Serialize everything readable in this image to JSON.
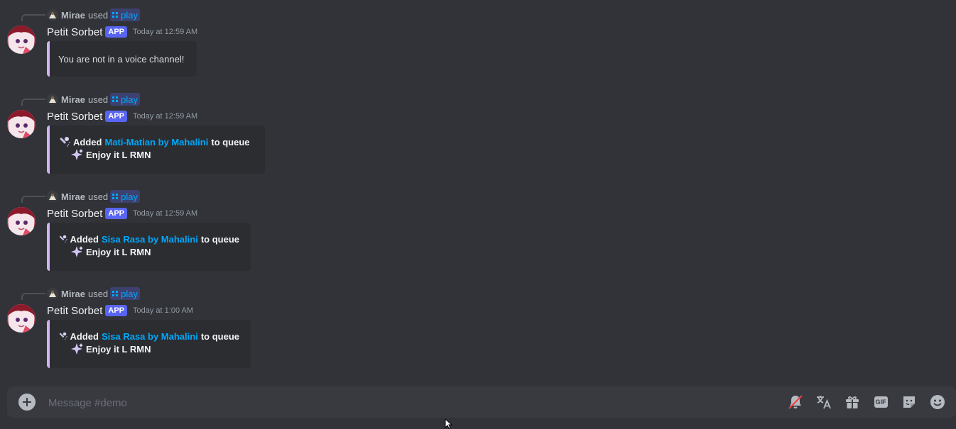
{
  "messages": [
    {
      "reply_user": "Mirae",
      "reply_used": "used",
      "command": "play",
      "bot_name": "Petit Sorbet",
      "badge": "APP",
      "timestamp": "Today at 12:59 AM",
      "embed_text": "You are not in a voice channel!"
    },
    {
      "reply_user": "Mirae",
      "reply_used": "used",
      "command": "play",
      "bot_name": "Petit Sorbet",
      "badge": "APP",
      "timestamp": "Today at 12:59 AM",
      "added_label": "Added",
      "song": "Mati-Matian by Mahalini",
      "to_queue": "to queue",
      "footer": "Enjoy it L RMN"
    },
    {
      "reply_user": "Mirae",
      "reply_used": "used",
      "command": "play",
      "bot_name": "Petit Sorbet",
      "badge": "APP",
      "timestamp": "Today at 12:59 AM",
      "added_label": "Added",
      "song": "Sisa Rasa by Mahalini",
      "to_queue": "to queue",
      "footer": "Enjoy it L RMN"
    },
    {
      "reply_user": "Mirae",
      "reply_used": "used",
      "command": "play",
      "bot_name": "Petit Sorbet",
      "badge": "APP",
      "timestamp": "Today at 1:00 AM",
      "added_label": "Added",
      "song": "Sisa Rasa by Mahalini",
      "to_queue": "to queue",
      "footer": "Enjoy it L RMN"
    }
  ],
  "composer": {
    "placeholder": "Message #demo",
    "gif_label": "GIF"
  },
  "colors": {
    "background": "#313338",
    "embed_bg": "#2b2d31",
    "embed_accent": "#d0b3f2",
    "link": "#00a8fc",
    "badge": "#5865f2"
  },
  "icons": [
    "attach-plus-icon",
    "mute-bell-icon",
    "translate-icon",
    "gift-icon",
    "gif-icon",
    "sticker-icon",
    "emoji-icon"
  ]
}
